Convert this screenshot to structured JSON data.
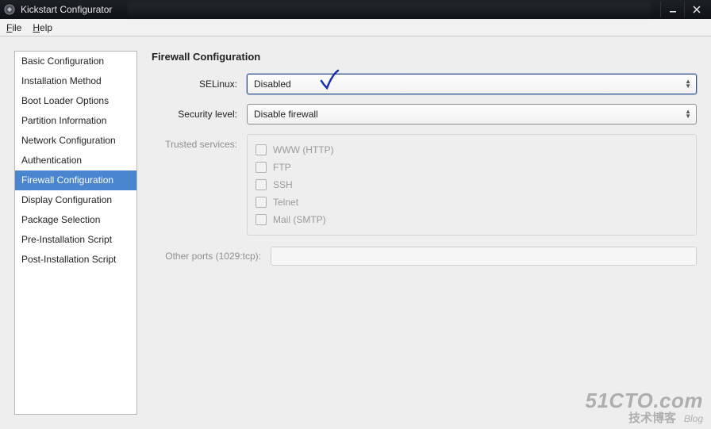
{
  "window": {
    "title": "Kickstart Configurator"
  },
  "menubar": {
    "file": {
      "accel": "F",
      "rest": "ile"
    },
    "help": {
      "accel": "H",
      "rest": "elp"
    }
  },
  "sidebar": {
    "items": [
      {
        "label": "Basic Configuration"
      },
      {
        "label": "Installation Method"
      },
      {
        "label": "Boot Loader Options"
      },
      {
        "label": "Partition Information"
      },
      {
        "label": "Network Configuration"
      },
      {
        "label": "Authentication"
      },
      {
        "label": "Firewall Configuration",
        "selected": true
      },
      {
        "label": "Display Configuration"
      },
      {
        "label": "Package Selection"
      },
      {
        "label": "Pre-Installation Script"
      },
      {
        "label": "Post-Installation Script"
      }
    ]
  },
  "main": {
    "section_title": "Firewall Configuration",
    "selinux": {
      "label": "SELinux:",
      "value": "Disabled"
    },
    "security_level": {
      "label": "Security level:",
      "value": "Disable firewall"
    },
    "trusted_services": {
      "label": "Trusted services:",
      "items": [
        {
          "label": "WWW (HTTP)"
        },
        {
          "label": "FTP"
        },
        {
          "label": "SSH"
        },
        {
          "label": "Telnet"
        },
        {
          "label": "Mail (SMTP)"
        }
      ]
    },
    "other_ports": {
      "label": "Other ports (1029:tcp):",
      "value": ""
    }
  },
  "watermark": {
    "big": "51CTO.com",
    "cn": "技术博客",
    "blog": "Blog"
  }
}
